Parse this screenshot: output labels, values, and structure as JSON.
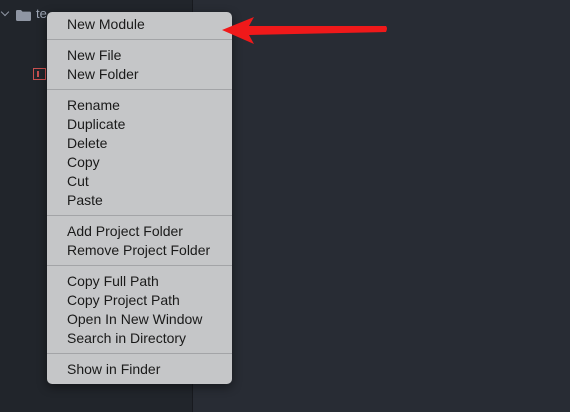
{
  "tree": {
    "root_label": "te",
    "icons": {
      "root": "folder-icon",
      "child": "file-icon"
    }
  },
  "menu": {
    "groups": [
      [
        "New Module"
      ],
      [
        "New File",
        "New Folder"
      ],
      [
        "Rename",
        "Duplicate",
        "Delete",
        "Copy",
        "Cut",
        "Paste"
      ],
      [
        "Add Project Folder",
        "Remove Project Folder"
      ],
      [
        "Copy Full Path",
        "Copy Project Path",
        "Open In New Window",
        "Search in Directory"
      ],
      [
        "Show in Finder"
      ]
    ]
  },
  "annotation": {
    "icon": "arrow-left-icon",
    "color": "#f0191a"
  },
  "colors": {
    "sidebar_bg": "#21252b",
    "editor_bg": "#282c34",
    "menu_bg": "#c5c6c8",
    "menu_text": "#1a1a1a",
    "tree_text": "#9da5b4"
  }
}
